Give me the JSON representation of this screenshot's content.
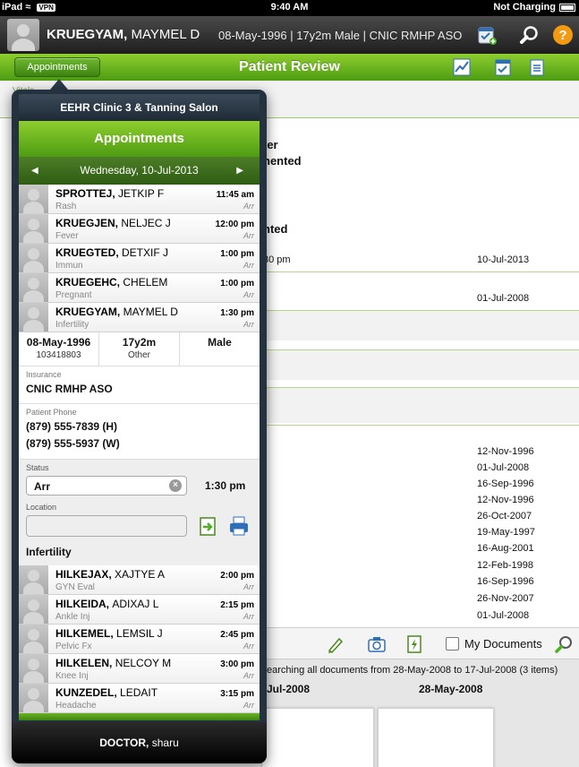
{
  "status_bar": {
    "device": "iPad",
    "vpn": "VPN",
    "time": "9:40 AM",
    "charging": "Not Charging"
  },
  "patient": {
    "last": "KRUEGYAM,",
    "first": "MAYMEL D",
    "info": "08-May-1996 | 17y2m Male | CNIC RMHP ASO"
  },
  "titlebar": {
    "appointments_button": "Appointments",
    "title": "Patient Review"
  },
  "background": {
    "vitals_tab": "Vitals",
    "text_1": "ter",
    "text_2": "nented",
    "text_3": "nted",
    "text_4": "30 pm",
    "date_a": "10-Jul-2013",
    "date_b": "01-Jul-2008",
    "date_list": [
      "12-Nov-1996",
      "01-Jul-2008",
      "16-Sep-1996",
      "12-Nov-1996",
      "26-Oct-2007",
      "19-May-1997",
      "16-Aug-2001",
      "12-Feb-1998",
      "16-Sep-1996",
      "26-Nov-2007",
      "01-Jul-2008"
    ],
    "my_documents": "My Documents",
    "searching": "earching all documents from 28-May-2008 to 17-Jul-2008 (3 items)",
    "doc_date_1": "Jul-2008",
    "doc_date_2": "28-May-2008"
  },
  "popover": {
    "clinic": "EEHR Clinic 3 & Tanning Salon",
    "title": "Appointments",
    "date": "Wednesday, 10-Jul-2013",
    "appointments_top": [
      {
        "last": "SPROTTEJ,",
        "first": "JETKIP F",
        "reason": "Rash",
        "time": "11:45 am",
        "status": "Arr"
      },
      {
        "last": "KRUEGJEN,",
        "first": "NELJEC J",
        "reason": "Fever",
        "time": "12:00 pm",
        "status": "Arr"
      },
      {
        "last": "KRUEGTED,",
        "first": "DETXIF J",
        "reason": "Immun",
        "time": "1:00 pm",
        "status": "Arr"
      },
      {
        "last": "KRUEGEHC,",
        "first": "CHELEM",
        "reason": "Pregnant",
        "time": "1:00 pm",
        "status": "Arr"
      },
      {
        "last": "KRUEGYAM,",
        "first": "MAYMEL D",
        "reason": "Infertility",
        "time": "1:30 pm",
        "status": "Arr"
      }
    ],
    "detail": {
      "dob": "08-May-1996",
      "mrn": "103418803",
      "age": "17y2m",
      "age_sub": "Other",
      "sex": "Male",
      "insurance_label": "Insurance",
      "insurance": "CNIC RMHP ASO",
      "phone_label": "Patient Phone",
      "phone_home": "(879) 555-7839 (H)",
      "phone_work": "(879) 555-5937 (W)",
      "status_label": "Status",
      "status_value": "Arr",
      "status_time": "1:30 pm",
      "location_label": "Location",
      "location_value": "",
      "reason": "Infertility"
    },
    "appointments_bottom": [
      {
        "last": "HILKEJAX,",
        "first": "XAJTYE A",
        "reason": "GYN Eval",
        "time": "2:00 pm",
        "status": "Arr"
      },
      {
        "last": "HILKEIDA,",
        "first": "ADIXAJ L",
        "reason": "Ankle Inj",
        "time": "2:15 pm",
        "status": "Arr"
      },
      {
        "last": "HILKEMEL,",
        "first": "LEMSIL J",
        "reason": "Pelvic Fx",
        "time": "2:45 pm",
        "status": "Arr"
      },
      {
        "last": "HILKELEN,",
        "first": "NELCOY M",
        "reason": "Knee Inj",
        "time": "3:00 pm",
        "status": "Arr"
      },
      {
        "last": "KUNZEDEL,",
        "first": "LEDAIT",
        "reason": "Headache",
        "time": "3:15 pm",
        "status": "Arr"
      }
    ],
    "footer_role": "DOCTOR,",
    "footer_user": "sharu"
  },
  "colors": {
    "brand_green": "#5fae1c",
    "popover_navy": "#243240"
  }
}
